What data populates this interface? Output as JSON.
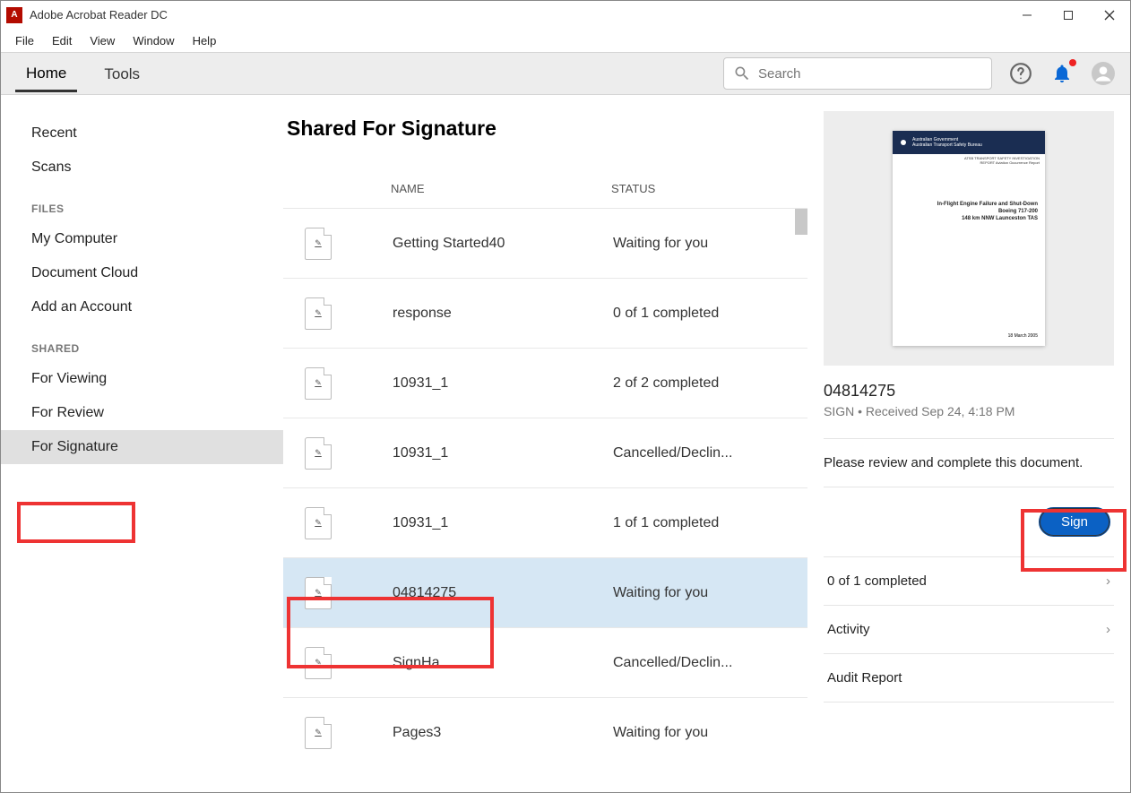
{
  "window": {
    "title": "Adobe Acrobat Reader DC"
  },
  "menubar": [
    "File",
    "Edit",
    "View",
    "Window",
    "Help"
  ],
  "tabs": {
    "home": "Home",
    "tools": "Tools"
  },
  "search": {
    "placeholder": "Search"
  },
  "sidebar": {
    "recent": "Recent",
    "scans": "Scans",
    "files_heading": "FILES",
    "my_computer": "My Computer",
    "document_cloud": "Document Cloud",
    "add_account": "Add an Account",
    "shared_heading": "SHARED",
    "for_viewing": "For Viewing",
    "for_review": "For Review",
    "for_signature": "For Signature"
  },
  "content": {
    "heading": "Shared For Signature",
    "col_name": "NAME",
    "col_status": "STATUS",
    "rows": [
      {
        "name": "Getting Started40",
        "status": "Waiting for you"
      },
      {
        "name": "response",
        "status": "0 of 1 completed"
      },
      {
        "name": "10931_1",
        "status": "2 of 2 completed"
      },
      {
        "name": "10931_1",
        "status": "Cancelled/Declin..."
      },
      {
        "name": "10931_1",
        "status": "1 of 1 completed"
      },
      {
        "name": "04814275",
        "status": "Waiting for you"
      },
      {
        "name": "SignHa",
        "status": "Cancelled/Declin..."
      },
      {
        "name": "Pages3",
        "status": "Waiting for you"
      }
    ]
  },
  "detail": {
    "title": "04814275",
    "meta": "SIGN  •  Received Sep 24, 4:18 PM",
    "message": "Please review and complete this document.",
    "sign_label": "Sign",
    "completed": "0 of 1 completed",
    "activity": "Activity",
    "audit": "Audit Report",
    "thumb": {
      "gov": "Australian Government",
      "bureau": "Australian Transport Safety Bureau",
      "line1": "In-Flight Engine Failure and Shut-Down",
      "line2": "Boeing 717-200",
      "line3": "148 km NNW Launceston TAS",
      "date": "18 March 2005"
    }
  }
}
